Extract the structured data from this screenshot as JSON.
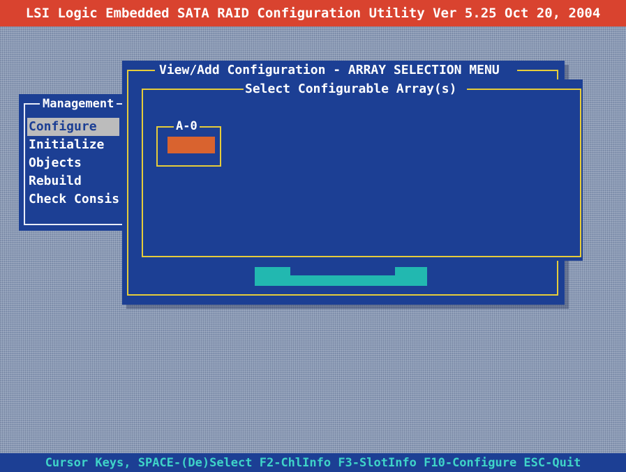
{
  "app": {
    "title": "LSI Logic Embedded SATA RAID Configuration Utility Ver 5.25 Oct 20, 2004"
  },
  "status_bar": {
    "text": "Cursor Keys, SPACE-(De)Select F2-ChlInfo F3-SlotInfo F10-Configure ESC-Quit"
  },
  "management_menu": {
    "title": "Management",
    "items": [
      {
        "label": "Configure",
        "selected": true
      },
      {
        "label": "Initialize",
        "selected": false
      },
      {
        "label": "Objects",
        "selected": false
      },
      {
        "label": "Rebuild",
        "selected": false
      },
      {
        "label": "Check Consis",
        "selected": false
      }
    ]
  },
  "dialog": {
    "title": "View/Add Configuration - ARRAY SELECTION MENU",
    "panel_title": "Select Configurable Array(s)",
    "arrays": [
      {
        "label": "A-0"
      }
    ]
  },
  "colors": {
    "title_bar": "#d9432f",
    "panel_blue": "#1c3f94",
    "frame_yellow": "#e6cc3a",
    "status_text": "#3fd4c8",
    "array_swatch": "#d9632f",
    "button_teal": "#22b8b0",
    "selection_gray": "#bcbcbc"
  }
}
